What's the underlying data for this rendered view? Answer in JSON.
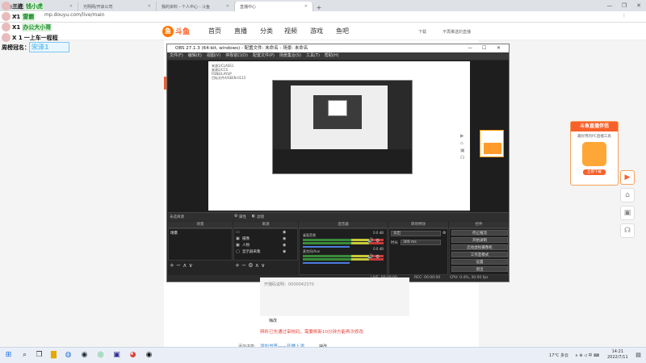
{
  "browser": {
    "tabs": [
      {
        "label": "斗鱼直播",
        "active": false
      },
      {
        "label": "光明网/开启公司",
        "active": false
      },
      {
        "label": "我的资料 - 个人中心 - 斗鱼",
        "active": false
      },
      {
        "label": "直播中心",
        "active": true
      }
    ],
    "new_tab": "+",
    "url": "mp.douyu.com/live/main",
    "window_controls": [
      "—",
      "❐",
      "✕"
    ]
  },
  "chat_overlay": {
    "lines": [
      {
        "prefix": "",
        "text": "三连",
        "highlight": "钱小虎"
      },
      {
        "prefix": "X1",
        "text": "",
        "highlight": "雷霸"
      },
      {
        "prefix": "X1",
        "text": "",
        "highlight": "办公大小哥"
      },
      {
        "prefix": "X 1",
        "text": "一上车一程程",
        "highlight": ""
      }
    ],
    "weekly_label": "周榜冠名：",
    "weekly_value": "宋泽1"
  },
  "site": {
    "logo_text": "斗鱼",
    "nav": [
      "首页",
      "直播",
      "分类",
      "视频",
      "游戏",
      "鱼吧"
    ],
    "nav_badges": {
      "视频": "●",
      "游戏": "NEW"
    },
    "header_right": [
      "下载",
      "不再推送的直播"
    ]
  },
  "obs": {
    "title": "OBS 27.1.3 (64-bit, windows) - 配置文件: 未命名 - 场景: 未命名",
    "menu": [
      "文件(F)",
      "编辑(E)",
      "视图(V)",
      "停靠窗口(D)",
      "配置文件(P)",
      "场景集合(S)",
      "工具(T)",
      "帮助(H)"
    ],
    "toolbar": {
      "scene_label": "未选择源",
      "properties": "属性",
      "filters": "滤镜"
    },
    "docks": {
      "scenes": {
        "title": "场景",
        "items": [
          "场景"
        ]
      },
      "sources": {
        "title": "来源",
        "items": [
          "",
          "摄像",
          "人物",
          "显示器采集"
        ]
      },
      "mixer": {
        "title": "混音器",
        "channels": [
          {
            "label": "桌面音频",
            "db": "0.0 dB"
          },
          {
            "label": "麦克风/Aux",
            "db": "0.0 dB"
          }
        ]
      },
      "transitions": {
        "title": "转场特效",
        "type": "淡出",
        "duration_label": "时长",
        "duration": "300 ms"
      },
      "controls": {
        "title": "控件",
        "buttons": [
          "停止推流",
          "开始录制",
          "启动虚拟摄像机",
          "工作室模式",
          "设置",
          "退出"
        ]
      }
    },
    "status": {
      "live": "LIVE: 00:00:00",
      "rec": "REC: 00:00:00",
      "cpu": "CPU: 0.4%, 30.00 fps",
      "kbps": "kb/s: 0"
    },
    "nested_list": [
      "来源1/CLASS1",
      "来源2/CCS",
      "FDNE/LAYUP",
      "目标文件A/SEEN-0115"
    ]
  },
  "page_body": {
    "article_text": "开播码说明：0000042370",
    "changelog_title": "梅改",
    "changelog_red": "辨析已先通过审核码，需要刷新10分钟方能再次修改",
    "bookmark_label": "添加书签:",
    "bookmark_link": "添加书签——开播上添",
    "bookmark_more": "抽改"
  },
  "sidebar_ad": {
    "title": "斗鱼直播伴侣",
    "subtitle": "最好用的PC直播工具",
    "button": "立即下载"
  },
  "side_buttons": [
    "▶",
    "⌂",
    "▣",
    "☊"
  ],
  "taskbar": {
    "weather": "17°C 多云",
    "tray": "∧ ⊕ ◁ 中 ⌨",
    "time": "14:21",
    "date": "2022/7/11"
  },
  "colors": {
    "accent": "#f8612b",
    "obs_bg": "#2b2b2b",
    "chat_highlight": "#1b8a2a"
  }
}
